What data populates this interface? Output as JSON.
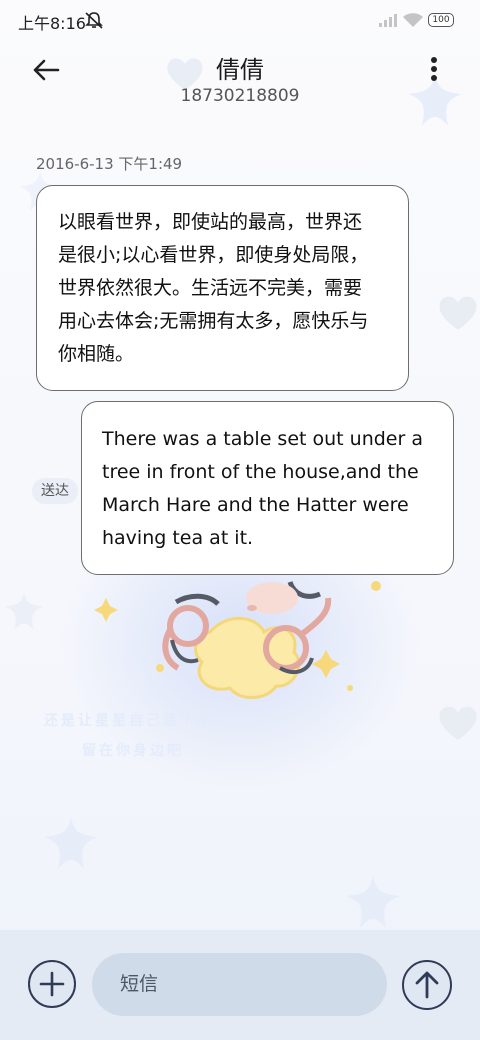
{
  "status_bar": {
    "time": "上午8:16",
    "battery_level": "100",
    "mute_icon": "mute-bell-icon",
    "signal_icon": "signal-icon",
    "wifi_icon": "wifi-icon"
  },
  "header": {
    "back_icon": "back-arrow-icon",
    "contact_name": "倩倩",
    "contact_number": "18730218809",
    "more_icon": "more-vertical-icon"
  },
  "conversation": {
    "timestamp": "2016-6-13 下午1:49",
    "messages": [
      {
        "direction": "incoming",
        "lines": [
          "以眼看世界，即使站的最高，世界还",
          "是很小;以心看世界，即使身处局限，",
          "世界依然很大。生活远不完美，需要",
          "用心去体会;无需拥有太多，愿快乐与",
          "你相随。"
        ]
      },
      {
        "direction": "outgoing",
        "lines": [
          "There was a table set out under a",
          "tree in front of the house,and the",
          "March Hare and the Hatter were",
          "having tea at it."
        ],
        "status": "送达"
      }
    ]
  },
  "wallpaper": {
    "caption_lines": [
      "还是让星星自己落下来",
      "留在你身边吧"
    ]
  },
  "input_bar": {
    "add_icon": "plus-icon",
    "placeholder": "短信",
    "send_icon": "send-arrow-icon"
  },
  "colors": {
    "background": "#f6f8fc",
    "bubble": "#ffffff",
    "bubble_border": "#6d6d6d",
    "input_bar": "#e5ebf4",
    "input_field": "#cfdbe9",
    "icon_dark": "#2f3b57"
  }
}
